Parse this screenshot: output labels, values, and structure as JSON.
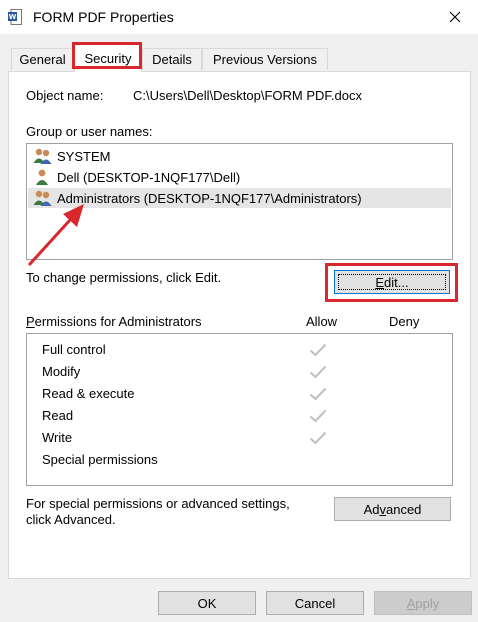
{
  "window": {
    "title": "FORM PDF Properties"
  },
  "tabs": [
    {
      "label": "General",
      "active": false
    },
    {
      "label": "Security",
      "active": true
    },
    {
      "label": "Details",
      "active": false
    },
    {
      "label": "Previous Versions",
      "active": false
    }
  ],
  "security": {
    "object_label": "Object name:",
    "object_value": "C:\\Users\\Dell\\Desktop\\FORM PDF.docx",
    "group_label": "Group or user names:",
    "users": [
      {
        "name": "SYSTEM",
        "icon": "group-users-icon",
        "selected": false
      },
      {
        "name": "Dell (DESKTOP-1NQF177\\Dell)",
        "icon": "user-icon",
        "selected": false
      },
      {
        "name": "Administrators (DESKTOP-1NQF177\\Administrators)",
        "icon": "group-users-icon",
        "selected": true
      }
    ],
    "change_text": "To change permissions, click Edit.",
    "edit_button": {
      "pre": "",
      "accel": "E",
      "post": "dit..."
    },
    "permissions_label": {
      "accel": "P",
      "rest": "ermissions for Administrators"
    },
    "allow_header": "Allow",
    "deny_header": "Deny",
    "permissions": [
      {
        "name": "Full control",
        "allow": true,
        "deny": false
      },
      {
        "name": "Modify",
        "allow": true,
        "deny": false
      },
      {
        "name": "Read & execute",
        "allow": true,
        "deny": false
      },
      {
        "name": "Read",
        "allow": true,
        "deny": false
      },
      {
        "name": "Write",
        "allow": true,
        "deny": false
      },
      {
        "name": "Special permissions",
        "allow": false,
        "deny": false
      }
    ],
    "advanced_text_1": "For special permissions or advanced settings,",
    "advanced_text_2": "click Advanced.",
    "advanced_button": {
      "pre": "Ad",
      "accel": "v",
      "post": "anced"
    }
  },
  "footer": {
    "ok_label": "OK",
    "cancel_label": "Cancel",
    "apply_button": {
      "accel": "A",
      "post": "pply"
    }
  },
  "colors": {
    "highlight": "#d9272e",
    "check": "#bfbfbf",
    "focus_border": "#0078d7"
  }
}
